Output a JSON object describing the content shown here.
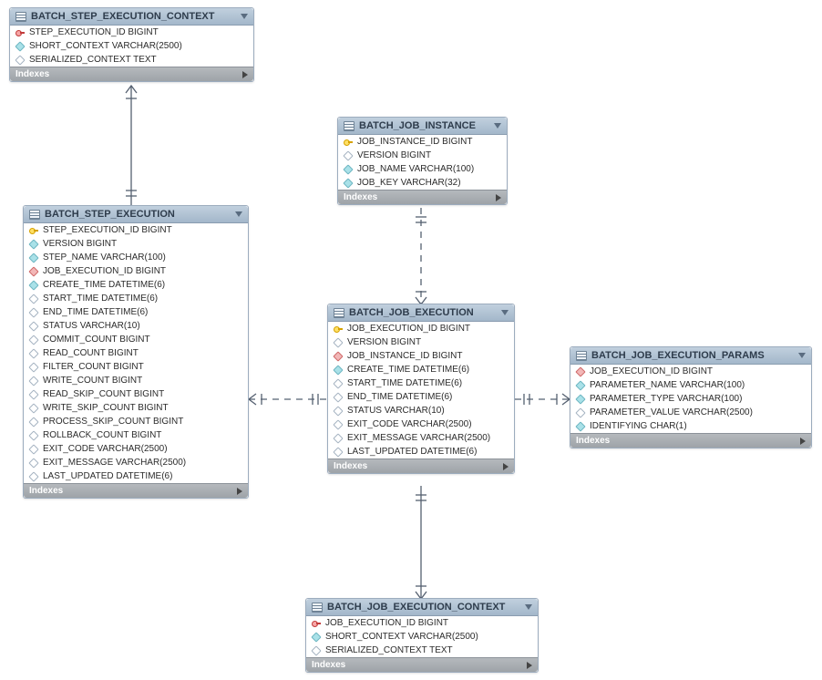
{
  "entities": {
    "stepctx": {
      "title": "BATCH_STEP_EXECUTION_CONTEXT",
      "cols": [
        {
          "name": "STEP_EXECUTION_ID BIGINT",
          "icon": "fkpk"
        },
        {
          "name": "SHORT_CONTEXT VARCHAR(2500)",
          "icon": "filled"
        },
        {
          "name": "SERIALIZED_CONTEXT TEXT",
          "icon": "hollow"
        }
      ],
      "footer": "Indexes"
    },
    "jobinst": {
      "title": "BATCH_JOB_INSTANCE",
      "cols": [
        {
          "name": "JOB_INSTANCE_ID BIGINT",
          "icon": "pk"
        },
        {
          "name": "VERSION BIGINT",
          "icon": "hollow"
        },
        {
          "name": "JOB_NAME VARCHAR(100)",
          "icon": "filled"
        },
        {
          "name": "JOB_KEY VARCHAR(32)",
          "icon": "filled"
        }
      ],
      "footer": "Indexes"
    },
    "stepexec": {
      "title": "BATCH_STEP_EXECUTION",
      "cols": [
        {
          "name": "STEP_EXECUTION_ID BIGINT",
          "icon": "pk"
        },
        {
          "name": "VERSION BIGINT",
          "icon": "filled"
        },
        {
          "name": "STEP_NAME VARCHAR(100)",
          "icon": "filled"
        },
        {
          "name": "JOB_EXECUTION_ID BIGINT",
          "icon": "fk"
        },
        {
          "name": "CREATE_TIME DATETIME(6)",
          "icon": "filled"
        },
        {
          "name": "START_TIME DATETIME(6)",
          "icon": "hollow"
        },
        {
          "name": "END_TIME DATETIME(6)",
          "icon": "hollow"
        },
        {
          "name": "STATUS VARCHAR(10)",
          "icon": "hollow"
        },
        {
          "name": "COMMIT_COUNT BIGINT",
          "icon": "hollow"
        },
        {
          "name": "READ_COUNT BIGINT",
          "icon": "hollow"
        },
        {
          "name": "FILTER_COUNT BIGINT",
          "icon": "hollow"
        },
        {
          "name": "WRITE_COUNT BIGINT",
          "icon": "hollow"
        },
        {
          "name": "READ_SKIP_COUNT BIGINT",
          "icon": "hollow"
        },
        {
          "name": "WRITE_SKIP_COUNT BIGINT",
          "icon": "hollow"
        },
        {
          "name": "PROCESS_SKIP_COUNT BIGINT",
          "icon": "hollow"
        },
        {
          "name": "ROLLBACK_COUNT BIGINT",
          "icon": "hollow"
        },
        {
          "name": "EXIT_CODE VARCHAR(2500)",
          "icon": "hollow"
        },
        {
          "name": "EXIT_MESSAGE VARCHAR(2500)",
          "icon": "hollow"
        },
        {
          "name": "LAST_UPDATED DATETIME(6)",
          "icon": "hollow"
        }
      ],
      "footer": "Indexes"
    },
    "jobexec": {
      "title": "BATCH_JOB_EXECUTION",
      "cols": [
        {
          "name": "JOB_EXECUTION_ID BIGINT",
          "icon": "pk"
        },
        {
          "name": "VERSION BIGINT",
          "icon": "hollow"
        },
        {
          "name": "JOB_INSTANCE_ID BIGINT",
          "icon": "fk"
        },
        {
          "name": "CREATE_TIME DATETIME(6)",
          "icon": "filled"
        },
        {
          "name": "START_TIME DATETIME(6)",
          "icon": "hollow"
        },
        {
          "name": "END_TIME DATETIME(6)",
          "icon": "hollow"
        },
        {
          "name": "STATUS VARCHAR(10)",
          "icon": "hollow"
        },
        {
          "name": "EXIT_CODE VARCHAR(2500)",
          "icon": "hollow"
        },
        {
          "name": "EXIT_MESSAGE VARCHAR(2500)",
          "icon": "hollow"
        },
        {
          "name": "LAST_UPDATED DATETIME(6)",
          "icon": "hollow"
        }
      ],
      "footer": "Indexes"
    },
    "jobparams": {
      "title": "BATCH_JOB_EXECUTION_PARAMS",
      "cols": [
        {
          "name": "JOB_EXECUTION_ID BIGINT",
          "icon": "fk"
        },
        {
          "name": "PARAMETER_NAME VARCHAR(100)",
          "icon": "filled"
        },
        {
          "name": "PARAMETER_TYPE VARCHAR(100)",
          "icon": "filled"
        },
        {
          "name": "PARAMETER_VALUE VARCHAR(2500)",
          "icon": "hollow"
        },
        {
          "name": "IDENTIFYING CHAR(1)",
          "icon": "filled"
        }
      ],
      "footer": "Indexes"
    },
    "jobexecctx": {
      "title": "BATCH_JOB_EXECUTION_CONTEXT",
      "cols": [
        {
          "name": "JOB_EXECUTION_ID BIGINT",
          "icon": "fkpk"
        },
        {
          "name": "SHORT_CONTEXT VARCHAR(2500)",
          "icon": "filled"
        },
        {
          "name": "SERIALIZED_CONTEXT TEXT",
          "icon": "hollow"
        }
      ],
      "footer": "Indexes"
    }
  }
}
